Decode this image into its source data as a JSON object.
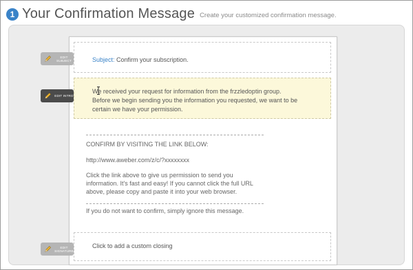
{
  "header": {
    "step_number": "1",
    "title": "Your Confirmation Message",
    "subtitle": "Create your customized confirmation message."
  },
  "edit_buttons": {
    "subject": "EDIT SUBJECT",
    "intro": "EDIT INTRO",
    "closing": "EDIT SIGNATURE"
  },
  "email": {
    "subject_label": "Subject:",
    "subject_value": "Confirm your subscription.",
    "intro": "We received your request for information from the frzzledoptin group. Before we begin sending you the information you requested, we want to be certain we have your permission.",
    "confirm_heading": "CONFIRM BY VISITING THE LINK BELOW:",
    "confirm_url": "http://www.aweber.com/z/c/?xxxxxxxx",
    "confirm_instructions": "Click the link above to give us permission to send you information. It's fast and easy! If you cannot click the full URL above, please copy and paste it into your web browser.",
    "ignore_text": "If you do not want to confirm, simply ignore this message.",
    "closing_placeholder": "Click to add a custom closing"
  },
  "colors": {
    "accent": "#3a83c8",
    "intro_highlight": "#fcf8da",
    "panel": "#ececec"
  },
  "icons": {
    "edit": "pencil-icon",
    "step": "step-number-badge"
  }
}
